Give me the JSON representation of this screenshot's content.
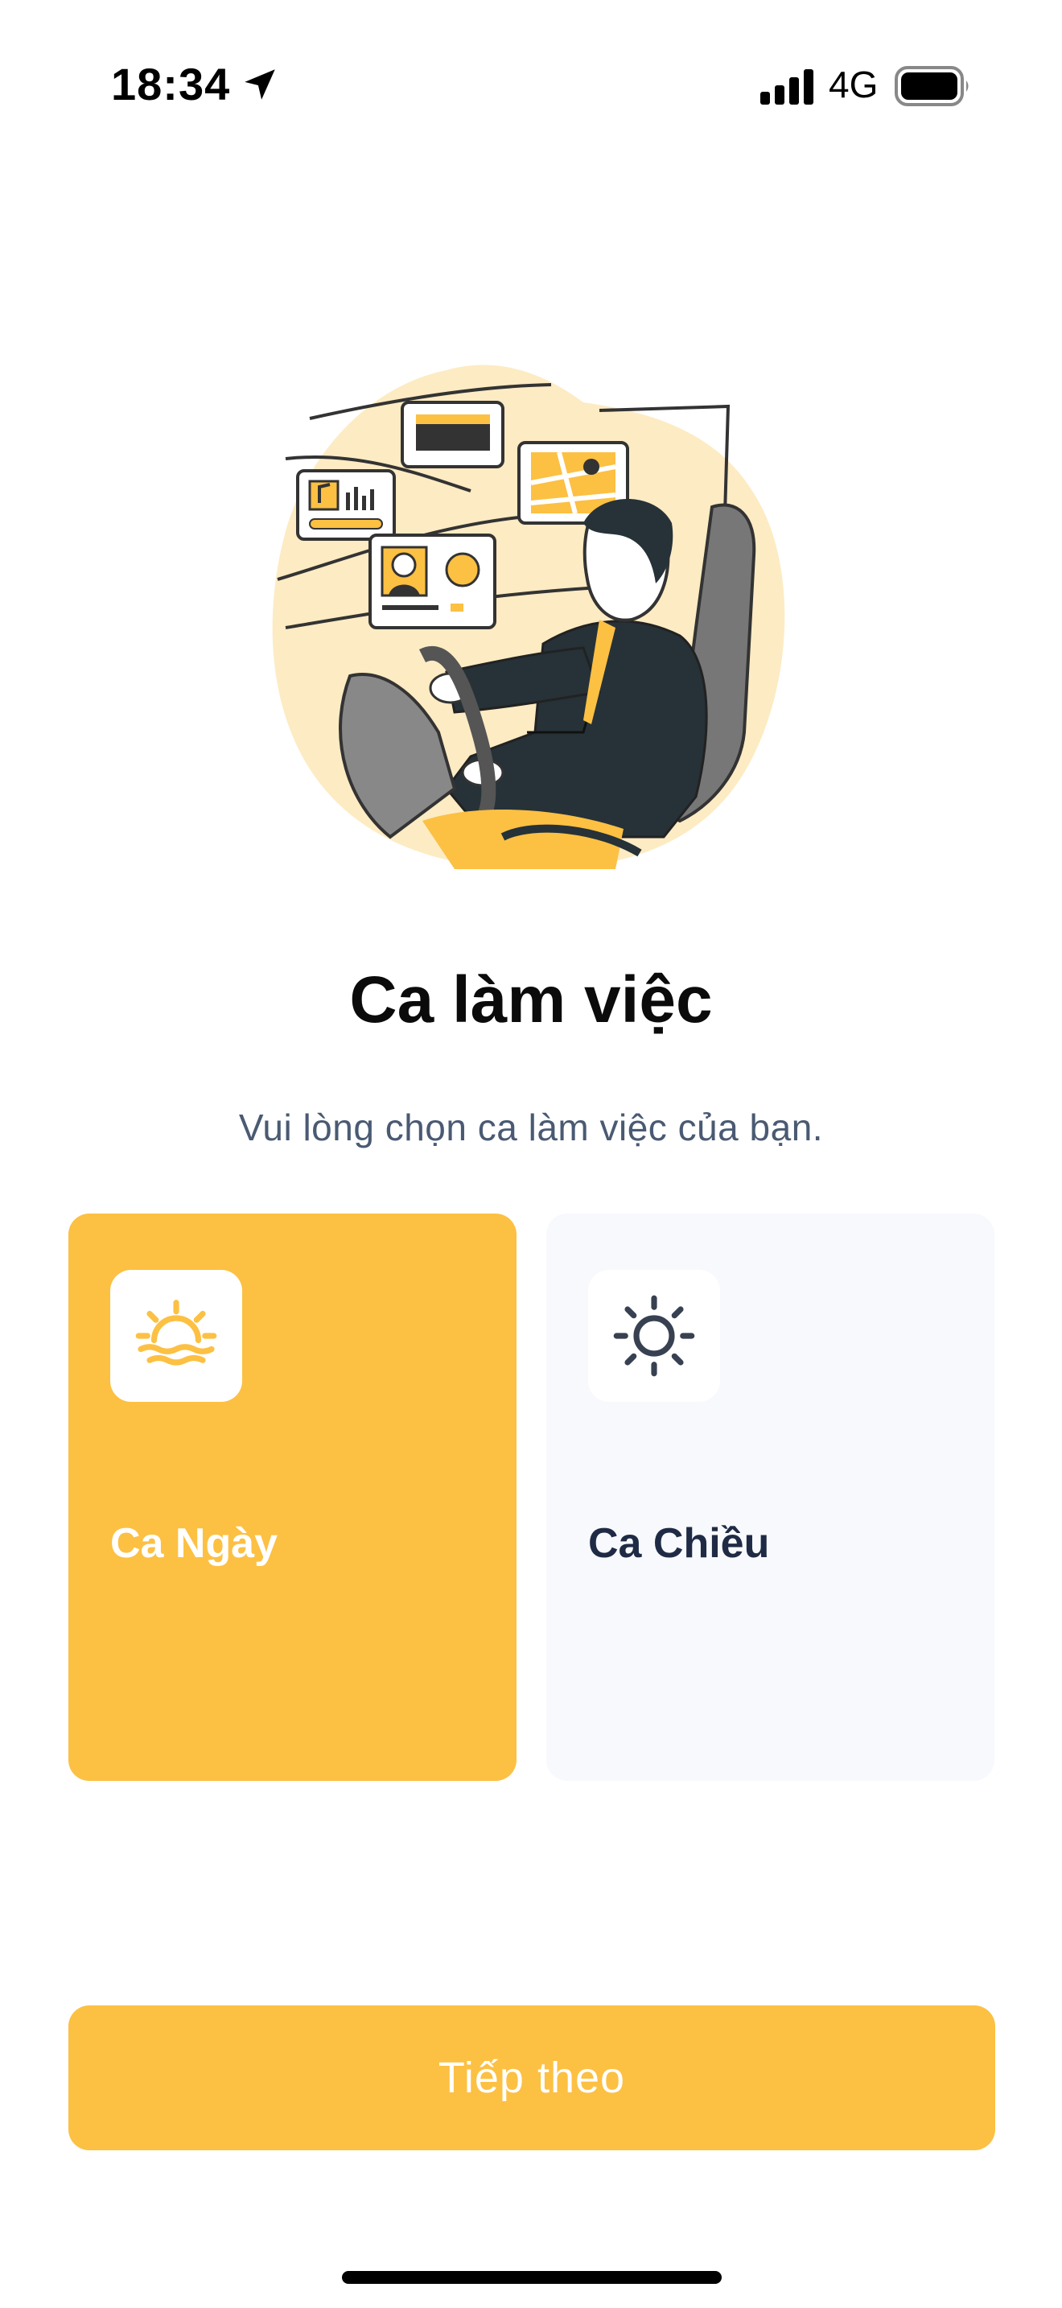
{
  "status_bar": {
    "time": "18:34",
    "network": "4G",
    "icons": [
      "location-arrow-icon",
      "cellular-signal-icon",
      "battery-icon"
    ]
  },
  "illustration": {
    "icon": "driver-illustration"
  },
  "page": {
    "title": "Ca làm việc",
    "subtitle": "Vui lòng chọn ca làm việc của bạn."
  },
  "shifts": [
    {
      "label": "Ca Ngày",
      "icon": "sunrise-icon",
      "selected": true
    },
    {
      "label": "Ca Chiều",
      "icon": "sun-icon",
      "selected": false
    }
  ],
  "next_button": {
    "label": "Tiếp theo"
  },
  "colors": {
    "accent": "#fcc043",
    "card_inactive": "#f7f9fd",
    "subtitle": "#4a5a73",
    "dark_text": "#1f2b45"
  }
}
